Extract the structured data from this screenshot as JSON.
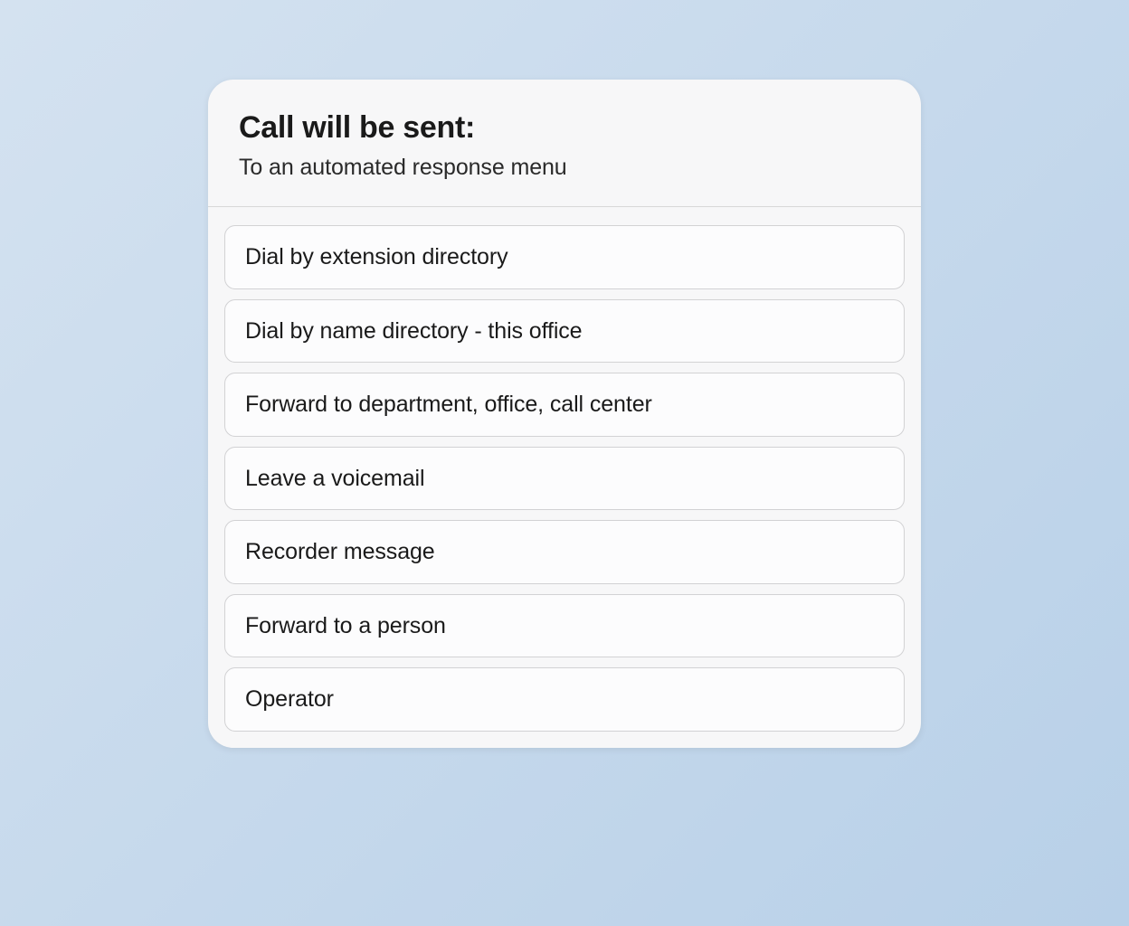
{
  "header": {
    "title": "Call will be sent:",
    "subtitle": "To an automated response menu"
  },
  "options": [
    {
      "label": "Dial by extension directory"
    },
    {
      "label": "Dial by name directory - this office"
    },
    {
      "label": "Forward to department, office, call center"
    },
    {
      "label": "Leave a voicemail"
    },
    {
      "label": "Recorder message"
    },
    {
      "label": "Forward to a person"
    },
    {
      "label": "Operator"
    }
  ]
}
